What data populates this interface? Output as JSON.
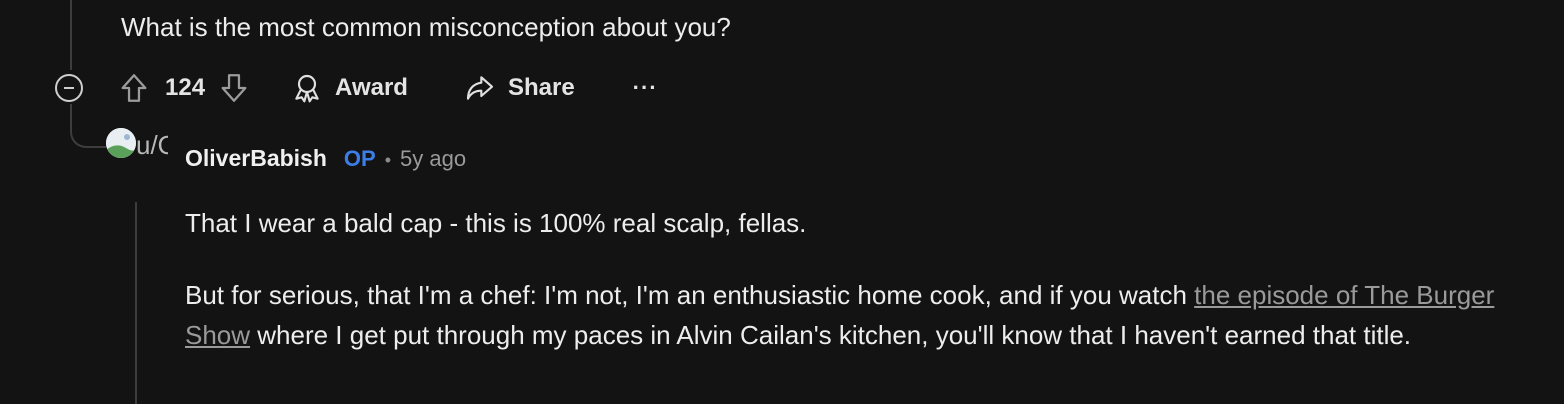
{
  "parent": {
    "text": "What is the most common misconception about you?"
  },
  "actions": {
    "score": "124",
    "award_label": "Award",
    "share_label": "Share",
    "more_label": "···"
  },
  "reply": {
    "avatar_alt": "u/OliverBabish",
    "author": "OliverBabish",
    "op_badge": "OP",
    "separator": "•",
    "time": "5y ago",
    "paragraph1": "That I wear a bald cap - this is 100% real scalp, fellas.",
    "paragraph2_before": "But for serious, that I'm a chef: I'm not, I'm an enthusiastic home cook, and if you watch ",
    "paragraph2_link": "the episode of The Burger Show",
    "paragraph2_after": " where I get put through my paces in Alvin Cailan's kitchen, you'll know that I haven't earned that title."
  },
  "colors": {
    "background": "#131313",
    "op_badge": "#3c7ee8",
    "link": "#9a9a9a"
  },
  "icons": [
    "collapse-icon",
    "upvote-icon",
    "downvote-icon",
    "award-icon",
    "share-icon"
  ]
}
